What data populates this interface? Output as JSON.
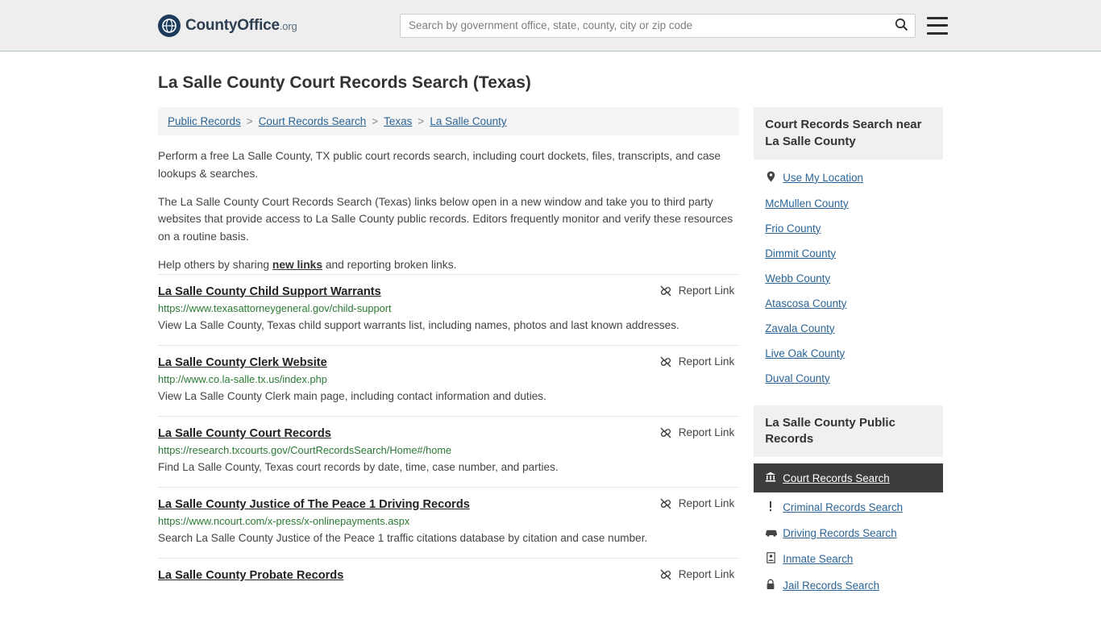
{
  "header": {
    "logo_text": "CountyOffice",
    "logo_tld": ".org",
    "logo_icon": "globe-icon",
    "search_placeholder": "Search by government office, state, county, city or zip code",
    "search_value": "",
    "search_icon": "search-icon",
    "menu_icon": "hamburger-menu-icon"
  },
  "page_title": "La Salle County Court Records Search (Texas)",
  "breadcrumb": [
    "Public Records",
    "Court Records Search",
    "Texas",
    "La Salle County"
  ],
  "breadcrumb_separator": ">",
  "intro": {
    "p1": "Perform a free La Salle County, TX public court records search, including court dockets, files, transcripts, and case lookups & searches.",
    "p2": "The La Salle County Court Records Search (Texas) links below open in a new window and take you to third party websites that provide access to La Salle County public records. Editors frequently monitor and verify these resources on a routine basis.",
    "p3_before": "Help others by sharing ",
    "p3_link": "new links",
    "p3_after": " and reporting broken links."
  },
  "report_label": "Report Link",
  "report_icon": "broken-link-icon",
  "results": [
    {
      "title": "La Salle County Child Support Warrants",
      "url": "https://www.texasattorneygeneral.gov/child-support",
      "desc": "View La Salle County, Texas child support warrants list, including names, photos and last known addresses."
    },
    {
      "title": "La Salle County Clerk Website",
      "url": "http://www.co.la-salle.tx.us/index.php",
      "desc": "View La Salle County Clerk main page, including contact information and duties."
    },
    {
      "title": "La Salle County Court Records",
      "url": "https://research.txcourts.gov/CourtRecordsSearch/Home#/home",
      "desc": "Find La Salle County, Texas court records by date, time, case number, and parties."
    },
    {
      "title": "La Salle County Justice of The Peace 1 Driving Records",
      "url": "https://www.ncourt.com/x-press/x-onlinepayments.aspx",
      "desc": "Search La Salle County Justice of the Peace 1 traffic citations database by citation and case number."
    },
    {
      "title": "La Salle County Probate Records",
      "url": "",
      "desc": ""
    }
  ],
  "sidebar": {
    "near_box": {
      "heading": "Court Records Search near La Salle County",
      "items": [
        {
          "label": "Use My Location",
          "icon": "location-pin-icon"
        },
        {
          "label": "McMullen County",
          "icon": ""
        },
        {
          "label": "Frio County",
          "icon": ""
        },
        {
          "label": "Dimmit County",
          "icon": ""
        },
        {
          "label": "Webb County",
          "icon": ""
        },
        {
          "label": "Atascosa County",
          "icon": ""
        },
        {
          "label": "Zavala County",
          "icon": ""
        },
        {
          "label": "Live Oak County",
          "icon": ""
        },
        {
          "label": "Duval County",
          "icon": ""
        }
      ]
    },
    "public_records_box": {
      "heading": "La Salle County Public Records",
      "items": [
        {
          "label": "Court Records Search",
          "icon": "bank-icon",
          "active": true
        },
        {
          "label": "Criminal Records Search",
          "icon": "exclamation-icon",
          "active": false
        },
        {
          "label": "Driving Records Search",
          "icon": "car-icon",
          "active": false
        },
        {
          "label": "Inmate Search",
          "icon": "person-icon",
          "active": false
        },
        {
          "label": "Jail Records Search",
          "icon": "lock-icon",
          "active": false
        }
      ]
    }
  },
  "colors": {
    "link": "#2a6496",
    "url_green": "#2a7a33",
    "header_bg": "#eeeeee",
    "active_bg": "#3d3d3d"
  }
}
